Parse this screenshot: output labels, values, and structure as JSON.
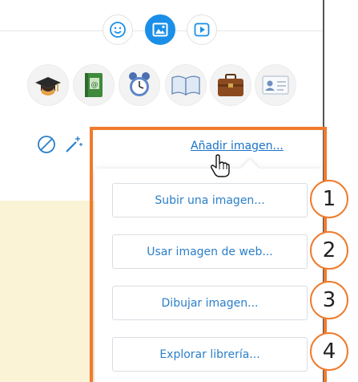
{
  "mode_tabs": [
    {
      "icon": "smiley-icon",
      "active": false
    },
    {
      "icon": "image-icon",
      "active": true
    },
    {
      "icon": "play-icon",
      "active": false
    }
  ],
  "clipart": [
    {
      "icon": "graduation-cap-icon"
    },
    {
      "icon": "address-book-icon"
    },
    {
      "icon": "alarm-clock-icon"
    },
    {
      "icon": "open-book-icon"
    },
    {
      "icon": "briefcase-icon"
    },
    {
      "icon": "id-card-icon"
    }
  ],
  "tools": [
    {
      "icon": "no-image-icon"
    },
    {
      "icon": "magic-wand-icon"
    }
  ],
  "add_image_link": "Añadir imagen...",
  "options": [
    {
      "label": "Subir una imagen...",
      "number": "1"
    },
    {
      "label": "Usar imagen de web...",
      "number": "2"
    },
    {
      "label": "Dibujar imagen...",
      "number": "3"
    },
    {
      "label": "Explorar librería...",
      "number": "4"
    }
  ],
  "colors": {
    "accent_blue": "#1b8fe8",
    "link_blue": "#1b73c9",
    "highlight_orange": "#ef7b2d",
    "beige": "#fbf3d5"
  }
}
